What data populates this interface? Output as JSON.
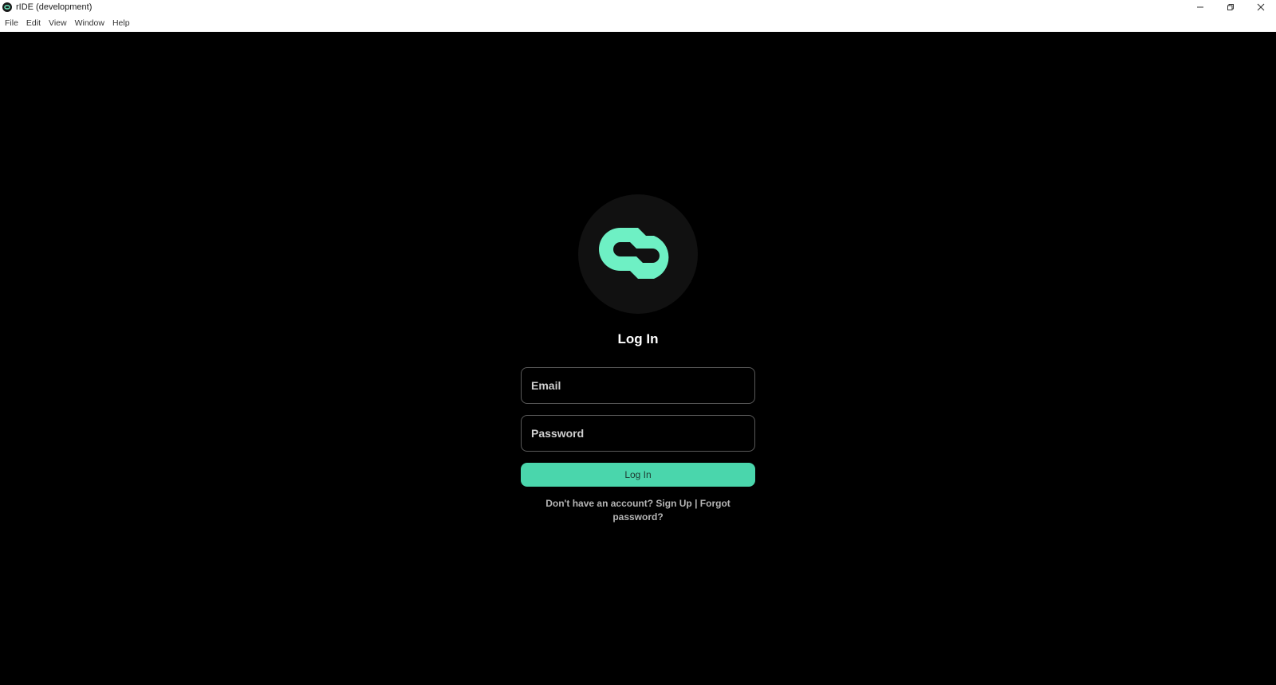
{
  "window": {
    "title": "rIDE (development)",
    "icon": "app-logo-icon"
  },
  "menu": {
    "items": [
      "File",
      "Edit",
      "View",
      "Window",
      "Help"
    ]
  },
  "login": {
    "title": "Log In",
    "email_placeholder": "Email",
    "password_placeholder": "Password",
    "button_label": "Log In",
    "no_account_text": "Don't have an account?",
    "signup_label": "Sign Up",
    "separator": "|",
    "forgot_label": "Forgot password?"
  },
  "colors": {
    "accent": "#4ad6ac",
    "logo": "#6ef0c4",
    "background": "#000000",
    "logo_circle": "#111111"
  }
}
